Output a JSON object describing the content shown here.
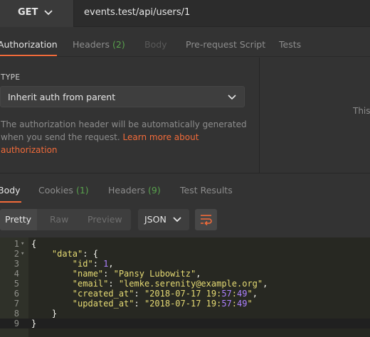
{
  "request": {
    "method": "GET",
    "url": "events.test/api/users/1"
  },
  "request_tabs": [
    {
      "label": "Authorization",
      "count": "",
      "state": "active"
    },
    {
      "label": "Headers",
      "count": "(2)",
      "state": "normal"
    },
    {
      "label": "Body",
      "count": "",
      "state": "disabled"
    },
    {
      "label": "Pre-request Script",
      "count": "",
      "state": "normal"
    },
    {
      "label": "Tests",
      "count": "",
      "state": "normal"
    }
  ],
  "auth": {
    "type_label": "TYPE",
    "selected_type": "Inherit auth from parent",
    "description_line1": "The authorization header will be automatically generated",
    "description_line2": "when you send the request.",
    "link_text": "Learn more about authorization",
    "right_panel_text": "This"
  },
  "response_tabs": [
    {
      "label": "Body",
      "count": "",
      "state": "active"
    },
    {
      "label": "Cookies",
      "count": "(1)",
      "state": "normal"
    },
    {
      "label": "Headers",
      "count": "(9)",
      "state": "normal"
    },
    {
      "label": "Test Results",
      "count": "",
      "state": "normal"
    }
  ],
  "toolbar": {
    "views": [
      "Pretty",
      "Raw",
      "Preview"
    ],
    "active_view": "Pretty",
    "format": "JSON",
    "wrap_icon": "wrap-lines-icon"
  },
  "code": {
    "line_numbers": [
      "1",
      "2",
      "3",
      "4",
      "5",
      "6",
      "7",
      "8",
      "9"
    ],
    "lines": [
      "{",
      "    \"data\": {",
      "        \"id\": 1,",
      "        \"name\": \"Pansy Lubowitz\",",
      "        \"email\": \"lemke.serenity@example.org\",",
      "        \"created_at\": \"2018-07-17 19:57:49\",",
      "        \"updated_at\": \"2018-07-17 19:57:49\"",
      "    }",
      "}"
    ]
  },
  "colors": {
    "accent": "#f26b3a",
    "count_green": "#59a24d",
    "editor_bg": "#272822",
    "string": "#e6db74",
    "number": "#ae81ff"
  }
}
